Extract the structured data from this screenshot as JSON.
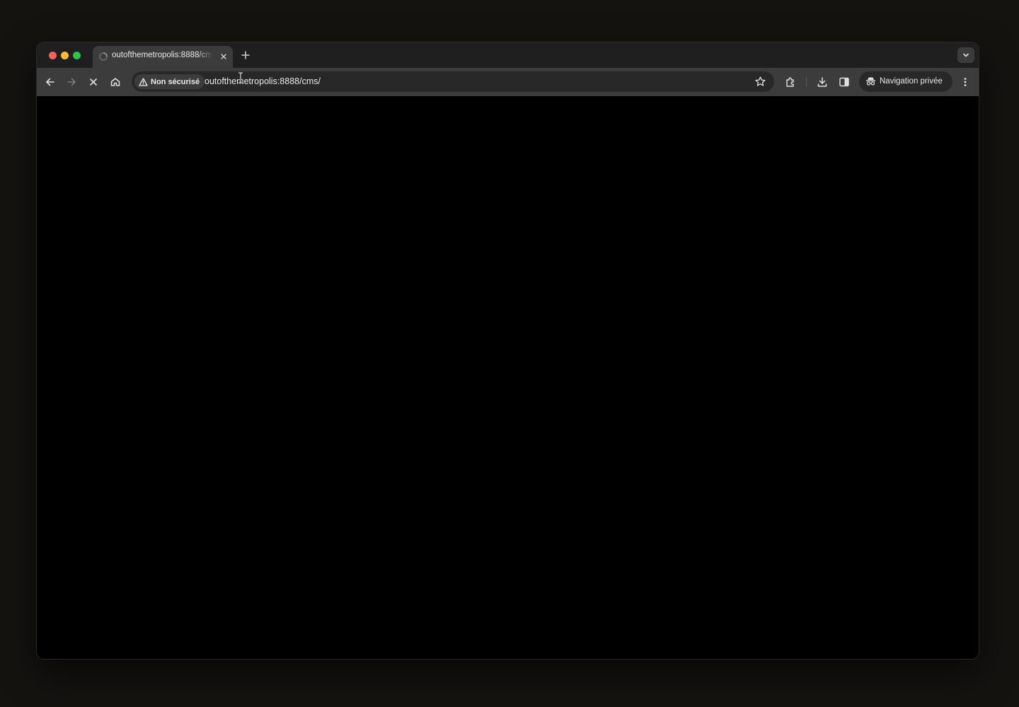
{
  "browser": {
    "tab": {
      "title": "outofthemetropolis:8888/cms/",
      "favicon": "loading-spinner-icon",
      "close_icon": "close-icon"
    },
    "new_tab_icon": "plus-icon",
    "tab_search_icon": "chevron-down-icon"
  },
  "toolbar": {
    "back_icon": "arrow-left-icon",
    "forward_icon": "arrow-right-icon",
    "stop_icon": "close-icon",
    "home_icon": "home-icon",
    "security_label": "Non sécurisé",
    "security_icon": "warning-triangle-icon",
    "url": "outofthemetropolis:8888/cms/",
    "bookmark_icon": "star-icon",
    "extensions_icon": "puzzle-icon",
    "downloads_icon": "download-icon",
    "side_panel_icon": "side-panel-icon",
    "private_label": "Navigation privée",
    "private_icon": "incognito-icon",
    "menu_icon": "more-vertical-icon"
  },
  "colors": {
    "desktop": "#141310",
    "tabstrip": "#1f1f1f",
    "toolbar": "#3c3c3c",
    "omnibox": "#282828",
    "content": "#000000",
    "text": "#e8e8e8"
  }
}
